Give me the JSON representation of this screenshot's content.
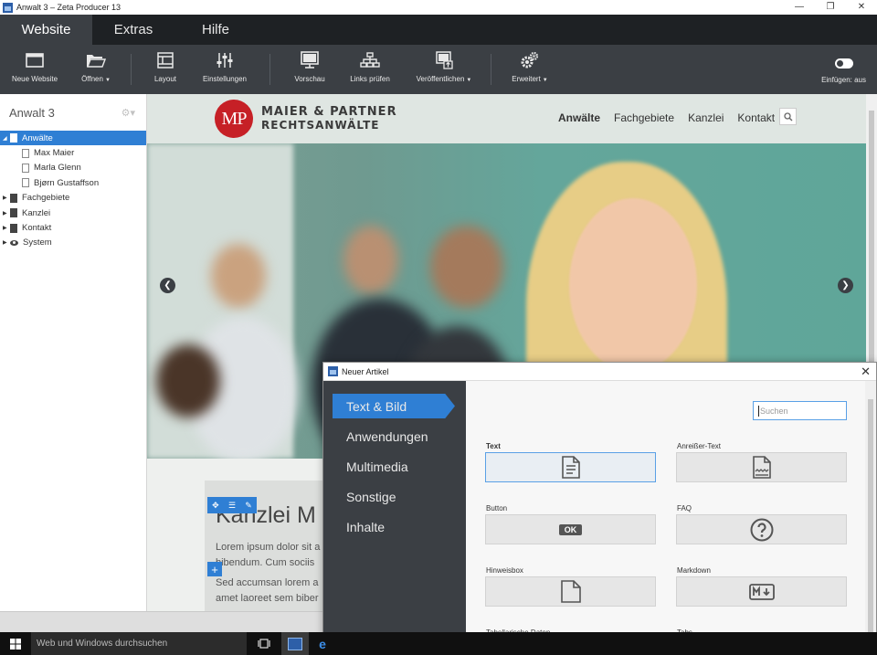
{
  "window": {
    "title": "Anwalt 3 – Zeta Producer 13"
  },
  "tabs": [
    {
      "label": "Website",
      "active": true
    },
    {
      "label": "Extras",
      "active": false
    },
    {
      "label": "Hilfe",
      "active": false
    }
  ],
  "toolbar": {
    "new_website": "Neue Website",
    "open": "Öffnen",
    "layout": "Layout",
    "settings": "Einstellungen",
    "preview": "Vorschau",
    "check_links": "Links prüfen",
    "publish": "Veröffentlichen",
    "advanced": "Erweitert",
    "insert": "Einfügen: aus"
  },
  "sidebar": {
    "project": "Anwalt 3",
    "items": [
      {
        "label": "Anwälte",
        "level": 0,
        "expanded": true,
        "selected": true
      },
      {
        "label": "Max Maier",
        "level": 1
      },
      {
        "label": "Marla Glenn",
        "level": 1
      },
      {
        "label": "Bjørn Gustaffson",
        "level": 1
      },
      {
        "label": "Fachgebiete",
        "level": 0
      },
      {
        "label": "Kanzlei",
        "level": 0
      },
      {
        "label": "Kontakt",
        "level": 0
      },
      {
        "label": "System",
        "level": 0
      }
    ]
  },
  "site": {
    "logo_initials": "MP",
    "logo_line1": "MAIER & PARTNER",
    "logo_line2": "RECHTSANWÄLTE",
    "nav": [
      "Anwälte",
      "Fachgebiete",
      "Kanzlei",
      "Kontakt"
    ],
    "active_nav": "Anwälte",
    "content_title": "Kanzlei M",
    "lorem1": "Lorem ipsum dolor sit a",
    "lorem2": "bibendum. Cum sociis",
    "lorem3": "Sed accumsan lorem a",
    "lorem4": "amet laoreet sem biber"
  },
  "dialog": {
    "title": "Neuer Artikel",
    "categories": [
      "Text & Bild",
      "Anwendungen",
      "Multimedia",
      "Sonstige",
      "Inhalte"
    ],
    "active_category": "Text & Bild",
    "search_placeholder": "Suchen",
    "items": [
      {
        "label": "Text",
        "icon": "text-document-icon",
        "selected": true
      },
      {
        "label": "Anreißer-Text",
        "icon": "teaser-document-icon"
      },
      {
        "label": "Button",
        "icon": "ok-button-icon",
        "button_text": "OK"
      },
      {
        "label": "FAQ",
        "icon": "question-icon"
      },
      {
        "label": "Hinweisbox",
        "icon": "blank-page-icon"
      },
      {
        "label": "Markdown",
        "icon": "markdown-icon"
      },
      {
        "label": "Tabellarische Daten",
        "icon": "table-icon"
      },
      {
        "label": "Tabs",
        "icon": "tabs-icon"
      }
    ]
  },
  "taskbar": {
    "search_text": "Web und Windows durchsuchen"
  },
  "colors": {
    "accent": "#2f7fd4",
    "ribbon": "#3b3f44",
    "logo_red": "#c62026"
  }
}
